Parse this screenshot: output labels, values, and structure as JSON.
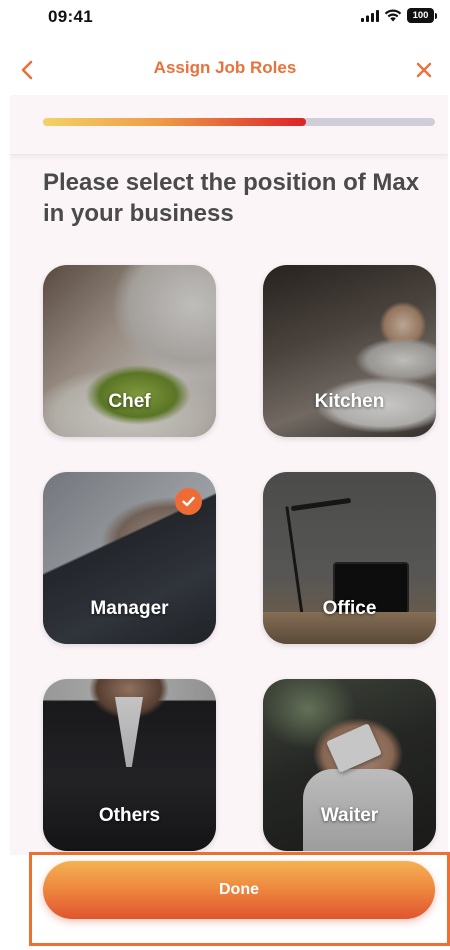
{
  "status_bar": {
    "time": "09:41",
    "battery": "100",
    "icons": [
      "signal-icon",
      "wifi-icon",
      "battery-icon"
    ]
  },
  "nav": {
    "title": "Assign Job Roles",
    "back_icon": "chevron-left-icon",
    "close_icon": "close-icon"
  },
  "progress": {
    "fraction": 0.67
  },
  "question": {
    "text": "Please select the position of Max in your business"
  },
  "roles": [
    {
      "label": "Chef",
      "selected": false
    },
    {
      "label": "Kitchen",
      "selected": false
    },
    {
      "label": "Manager",
      "selected": true
    },
    {
      "label": "Office",
      "selected": false
    },
    {
      "label": "Others",
      "selected": false
    },
    {
      "label": "Waiter",
      "selected": false
    }
  ],
  "footer": {
    "done_label": "Done"
  },
  "colors": {
    "accent": "#E8713C",
    "progress_start": "#F3D166",
    "progress_end": "#DC2227",
    "track": "#cfcdd6",
    "badge": "#EE6B35"
  }
}
